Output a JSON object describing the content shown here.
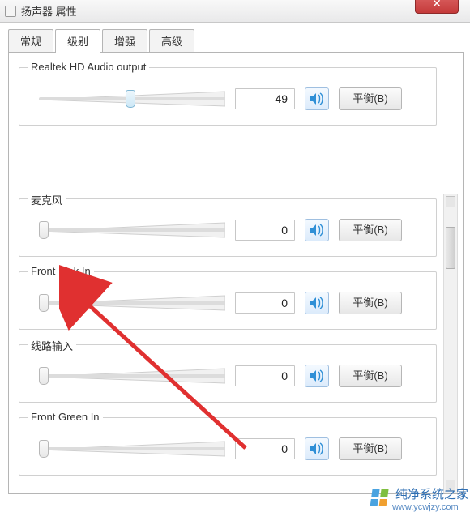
{
  "window": {
    "title": "扬声器 属性",
    "close_glyph": "✕"
  },
  "tabs": [
    {
      "label": "常规",
      "active": false
    },
    {
      "label": "级别",
      "active": true
    },
    {
      "label": "增强",
      "active": false
    },
    {
      "label": "高级",
      "active": false
    }
  ],
  "balance_label": "平衡(B)",
  "channels": [
    {
      "id": "realtek",
      "name": "Realtek HD Audio output",
      "value": "49",
      "percent": 49,
      "thumb_style": "blue"
    },
    {
      "id": "mic",
      "name": "麦克风",
      "value": "0",
      "percent": 2,
      "thumb_style": "plain"
    },
    {
      "id": "pinkin",
      "name": "Front Pink In",
      "value": "0",
      "percent": 2,
      "thumb_style": "plain",
      "name_partial_hidden": true
    },
    {
      "id": "linein",
      "name": "线路输入",
      "value": "0",
      "percent": 2,
      "thumb_style": "plain"
    },
    {
      "id": "greenin",
      "name": "Front Green In",
      "value": "0",
      "percent": 2,
      "thumb_style": "plain"
    }
  ],
  "watermark": {
    "brand": "纯净系统之家",
    "url": "www.ycwjzy.com"
  },
  "icons": {
    "speaker": "speaker-icon"
  },
  "colors": {
    "accent": "#2f8fd6",
    "close": "#c53a3a"
  }
}
